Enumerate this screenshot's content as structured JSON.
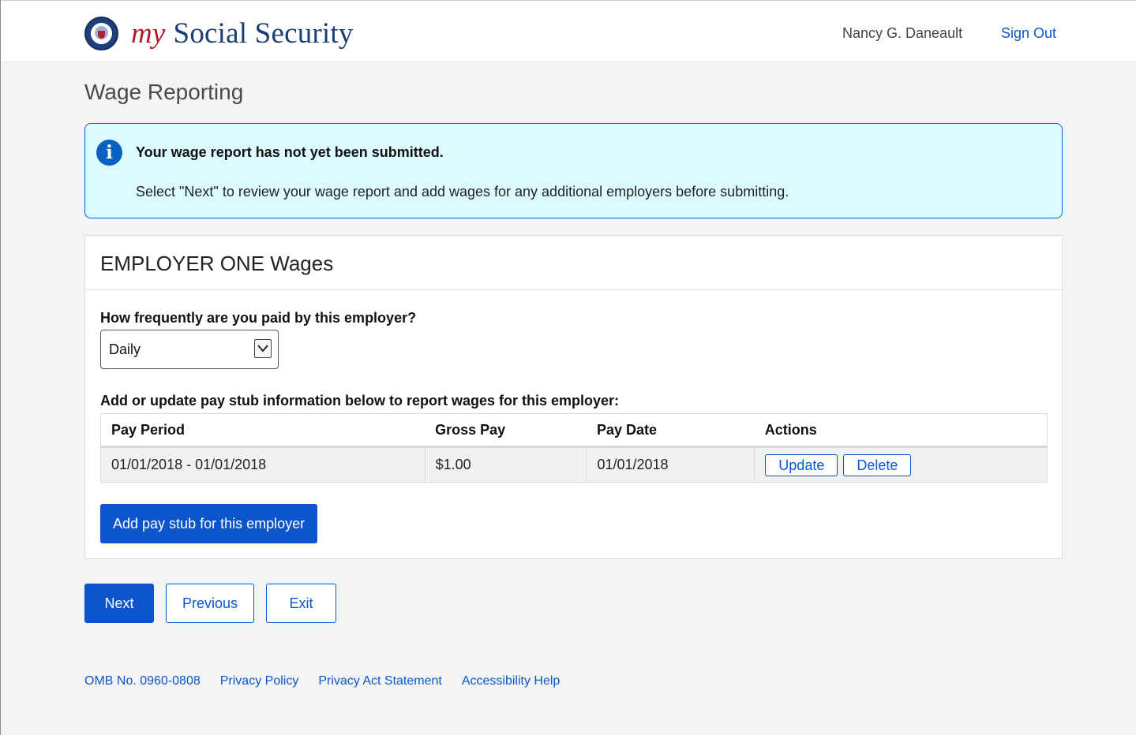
{
  "header": {
    "brand_my": "my",
    "brand_rest": "Social Security",
    "user_name": "Nancy G. Daneault",
    "sign_out": "Sign Out"
  },
  "page": {
    "title": "Wage Reporting"
  },
  "alert": {
    "icon": "info-icon",
    "title": "Your wage report has not yet been submitted.",
    "message": "Select \"Next\" to review your wage report and add wages for any additional employers before submitting."
  },
  "employer_card": {
    "title": "EMPLOYER ONE Wages",
    "frequency_question": "How frequently are you paid by this employer?",
    "frequency_selected": "Daily",
    "stub_instruction": "Add or update pay stub information below to report wages for this employer:",
    "columns": [
      "Pay Period",
      "Gross Pay",
      "Pay Date",
      "Actions"
    ],
    "rows": [
      {
        "pay_period": "01/01/2018 - 01/01/2018",
        "gross_pay": "$1.00",
        "pay_date": "01/01/2018",
        "update_label": "Update",
        "delete_label": "Delete"
      }
    ],
    "add_button": "Add pay stub for this employer"
  },
  "nav": {
    "next": "Next",
    "previous": "Previous",
    "exit": "Exit"
  },
  "footer": {
    "links": [
      "OMB No. 0960-0808",
      "Privacy Policy",
      "Privacy Act Statement",
      "Accessibility Help"
    ]
  },
  "colors": {
    "primary": "#0b55cc",
    "link": "#0a58ca",
    "alert_bg": "#dcfbff",
    "brand_red": "#b21c24",
    "brand_blue": "#1c3f73"
  }
}
